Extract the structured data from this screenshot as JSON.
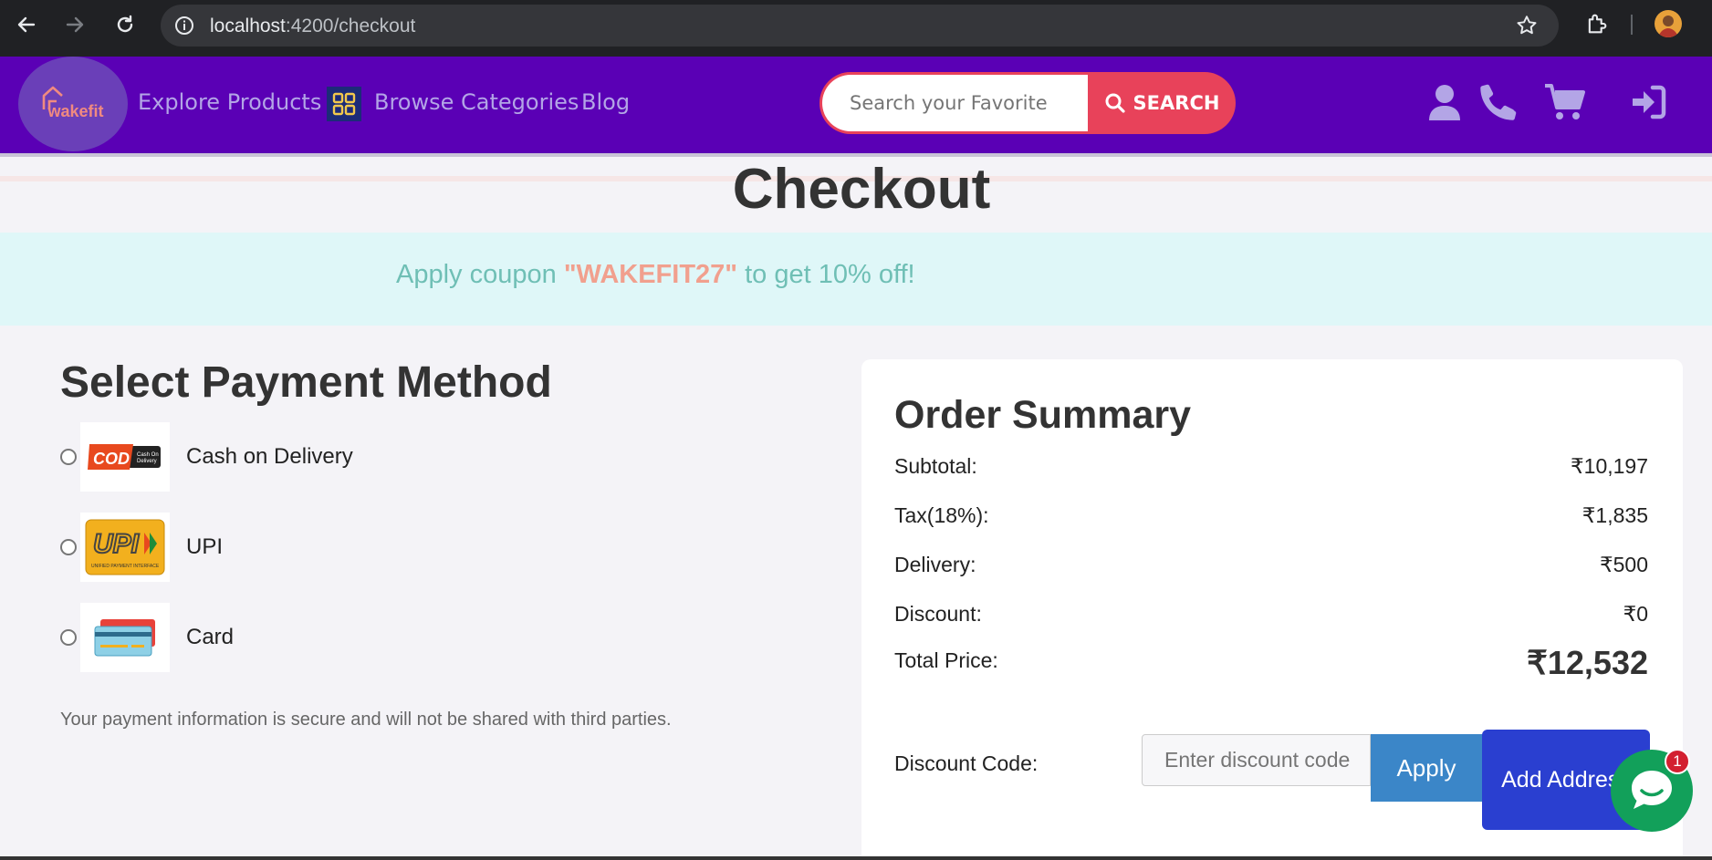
{
  "browser": {
    "url_host": "localhost",
    "url_path": ":4200/checkout",
    "icons": [
      "back-icon",
      "forward-icon",
      "reload-icon",
      "info-icon",
      "star-icon",
      "extensions-icon",
      "profile-avatar"
    ]
  },
  "navbar": {
    "logo_text": "wakefit",
    "links": {
      "explore": "Explore Products",
      "categories": "Browse Categories",
      "blog": "Blog"
    },
    "search": {
      "placeholder": "Search your Favorite",
      "button_label": "SEARCH"
    },
    "icons": [
      "user-icon",
      "phone-icon",
      "cart-icon",
      "login-icon"
    ],
    "colors": {
      "bg": "#5a00b5",
      "search_accent": "#e8425a",
      "links": "#b3a5e6"
    }
  },
  "page": {
    "title": "Checkout"
  },
  "coupon": {
    "prefix": "Apply coupon ",
    "code": "\"WAKEFIT27\"",
    "suffix": " to get 10% off!"
  },
  "payment": {
    "title": "Select Payment Method",
    "methods": [
      {
        "label": "Cash on Delivery",
        "icon": "cod-icon"
      },
      {
        "label": "UPI",
        "icon": "upi-icon"
      },
      {
        "label": "Card",
        "icon": "card-icon"
      }
    ],
    "secure_note": "Your payment information is secure and will not be shared with third parties."
  },
  "summary": {
    "title": "Order Summary",
    "rows": [
      {
        "label": "Subtotal:",
        "value": "₹10,197"
      },
      {
        "label": "Tax(18%):",
        "value": "₹1,835"
      },
      {
        "label": "Delivery:",
        "value": "₹500"
      },
      {
        "label": "Discount:",
        "value": "₹0"
      },
      {
        "label": "Total Price:",
        "value": "₹12,532"
      }
    ],
    "discount_label": "Discount Code:",
    "discount_placeholder": "Enter discount code",
    "apply_label": "Apply",
    "add_address_label": "Add Address"
  },
  "chat": {
    "badge": "1"
  }
}
